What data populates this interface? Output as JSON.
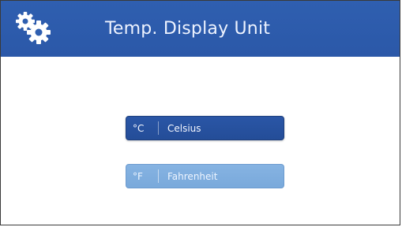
{
  "header": {
    "title": "Temp. Display Unit",
    "icon": "gears-icon"
  },
  "options": [
    {
      "symbol": "°C",
      "label": "Celsius",
      "selected": true
    },
    {
      "symbol": "°F",
      "label": "Fahrenheit",
      "selected": false
    }
  ],
  "colors": {
    "header": "#2f5fb0",
    "selected_button": "#2a56a6",
    "unselected_button": "#86b3e2"
  }
}
